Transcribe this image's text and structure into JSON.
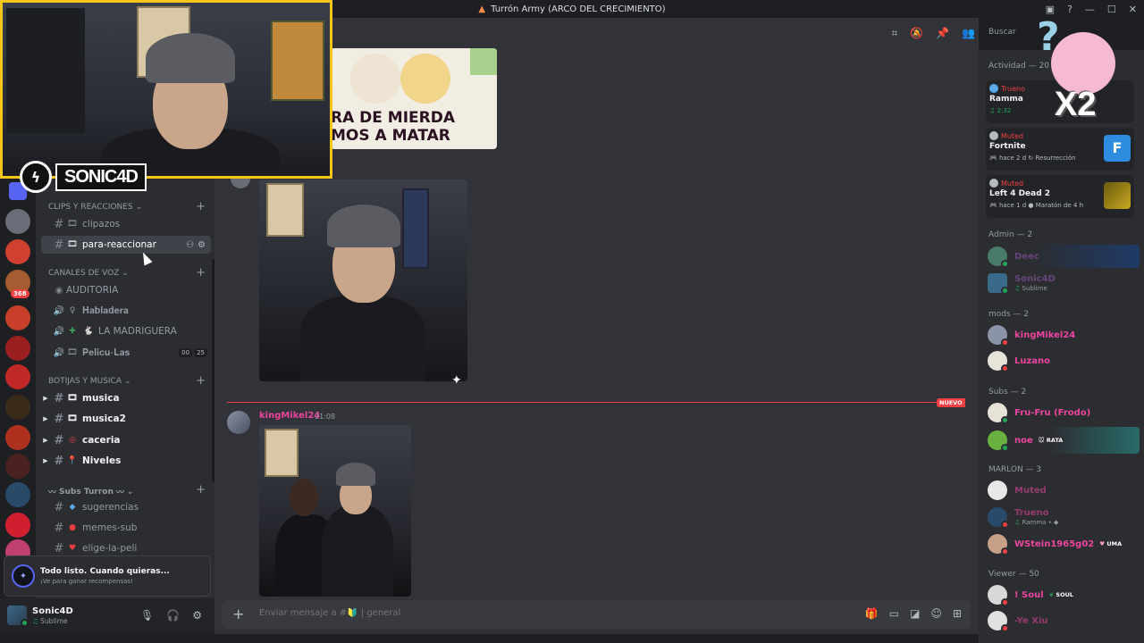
{
  "window": {
    "title": "Turrón Army (ARCO DEL CRECIMIENTO)",
    "controls": [
      "—",
      "☐",
      "✕"
    ]
  },
  "stream_overlay": {
    "logo_text": "SONIC4D",
    "mascot_text": "X2"
  },
  "server_rail": {
    "badge": "368"
  },
  "sidebar": {
    "categories": {
      "clips": "CLIPS Y REACCIONES",
      "voice": "CANALES DE VOZ",
      "bots": "BOTIJAS Y MUSICA",
      "subs": "Subs Turron"
    },
    "channels": {
      "clipazos": "clipazos",
      "reaccionar": "para-reaccionar",
      "auditoria": "AUDITORIA",
      "habladera": "𝐇𝐚𝐛𝐥𝐚𝐝𝐞𝐫𝐚",
      "madriguera": "LA MADRIGUERA",
      "pelicu": "𝐏𝐞𝐥𝐢𝐜𝐮-𝐋𝐚𝐬",
      "musica": "musica",
      "musica2": "musica2",
      "caceria": "caceria",
      "niveles": "Niveles",
      "sugerencias": "sugerencias",
      "memes": "memes-sub",
      "peli": "elige-la-peli"
    },
    "voice_counts": [
      "00",
      "25"
    ]
  },
  "promo": {
    "title": "Todo listo. Cuando quieras...",
    "subtitle": "¡Ve para ganar recompensas!"
  },
  "user": {
    "name": "Sonic4D",
    "status": "Sublime"
  },
  "chat": {
    "meme_text": "RA DE MIERDA\nMOS A MATAR",
    "new_label": "NUEVO",
    "message": {
      "author": "kingMikel24",
      "time": "21:08"
    },
    "composer_placeholder": "Enviar mensaje a #🔰 | general"
  },
  "search": {
    "placeholder": "Buscar"
  },
  "members": {
    "activity_header": "Actividad — 20",
    "activities": [
      {
        "label": "Trueno",
        "title": "Ramma",
        "sub": "2:32"
      },
      {
        "label": "Muted",
        "title": "Fortnite",
        "sub": "hace 2 d  ↻ Resurrección"
      },
      {
        "label": "Muted",
        "title": "Left 4 Dead 2",
        "sub": "hace 1 d  ● Maratón de 4 h"
      }
    ],
    "groups": {
      "admin": "Admin — 2",
      "mods": "mods — 2",
      "subs": "Subs — 2",
      "marlon": "MARLON — 3",
      "viewer": "Viewer — 50"
    },
    "list": {
      "deec": {
        "name": "Deec"
      },
      "sonic": {
        "name": "Sonic4D",
        "sub": "Sublime"
      },
      "kingmikel": {
        "name": "kingMikel24"
      },
      "luzano": {
        "name": "Luzano"
      },
      "frufru": {
        "name": "Fru-Fru (Frodo)"
      },
      "noe": {
        "name": "noe",
        "tag": "RATA"
      },
      "muted": {
        "name": "Muted"
      },
      "trueno": {
        "name": "Trueno",
        "sub": "Ramma • "
      },
      "wstein": {
        "name": "WStein1965g02",
        "tag": "UMA"
      },
      "soul": {
        "name": "! Soul",
        "tag": "SOUL"
      },
      "yexiu": {
        "name": "-Ye Xiu"
      }
    }
  },
  "colors": {
    "accent": "#5865f2",
    "danger": "#f23f43",
    "online": "#23a55a",
    "pink": "#eb459f",
    "webcam_border": "#f5c518"
  }
}
